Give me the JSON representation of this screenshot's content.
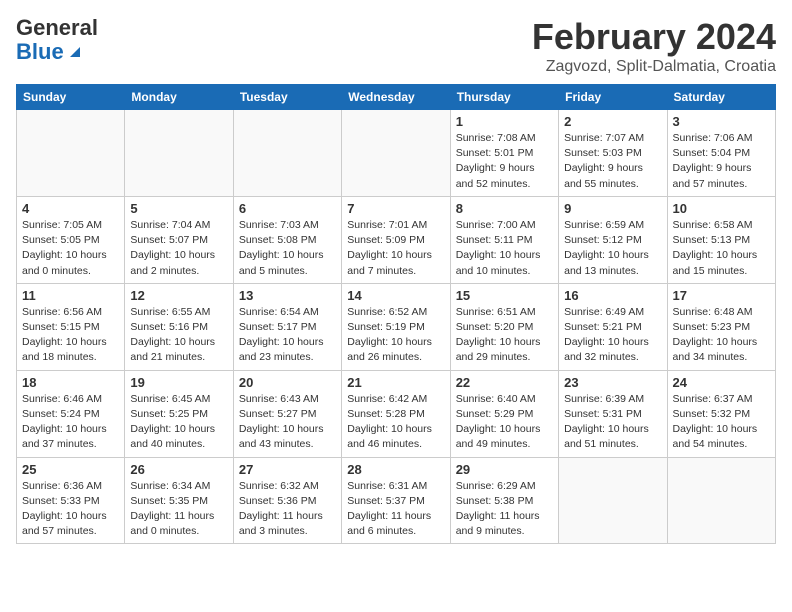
{
  "header": {
    "logo_line1": "General",
    "logo_line2": "Blue",
    "month": "February 2024",
    "location": "Zagvozd, Split-Dalmatia, Croatia"
  },
  "weekdays": [
    "Sunday",
    "Monday",
    "Tuesday",
    "Wednesday",
    "Thursday",
    "Friday",
    "Saturday"
  ],
  "weeks": [
    [
      {
        "day": "",
        "info": ""
      },
      {
        "day": "",
        "info": ""
      },
      {
        "day": "",
        "info": ""
      },
      {
        "day": "",
        "info": ""
      },
      {
        "day": "1",
        "info": "Sunrise: 7:08 AM\nSunset: 5:01 PM\nDaylight: 9 hours\nand 52 minutes."
      },
      {
        "day": "2",
        "info": "Sunrise: 7:07 AM\nSunset: 5:03 PM\nDaylight: 9 hours\nand 55 minutes."
      },
      {
        "day": "3",
        "info": "Sunrise: 7:06 AM\nSunset: 5:04 PM\nDaylight: 9 hours\nand 57 minutes."
      }
    ],
    [
      {
        "day": "4",
        "info": "Sunrise: 7:05 AM\nSunset: 5:05 PM\nDaylight: 10 hours\nand 0 minutes."
      },
      {
        "day": "5",
        "info": "Sunrise: 7:04 AM\nSunset: 5:07 PM\nDaylight: 10 hours\nand 2 minutes."
      },
      {
        "day": "6",
        "info": "Sunrise: 7:03 AM\nSunset: 5:08 PM\nDaylight: 10 hours\nand 5 minutes."
      },
      {
        "day": "7",
        "info": "Sunrise: 7:01 AM\nSunset: 5:09 PM\nDaylight: 10 hours\nand 7 minutes."
      },
      {
        "day": "8",
        "info": "Sunrise: 7:00 AM\nSunset: 5:11 PM\nDaylight: 10 hours\nand 10 minutes."
      },
      {
        "day": "9",
        "info": "Sunrise: 6:59 AM\nSunset: 5:12 PM\nDaylight: 10 hours\nand 13 minutes."
      },
      {
        "day": "10",
        "info": "Sunrise: 6:58 AM\nSunset: 5:13 PM\nDaylight: 10 hours\nand 15 minutes."
      }
    ],
    [
      {
        "day": "11",
        "info": "Sunrise: 6:56 AM\nSunset: 5:15 PM\nDaylight: 10 hours\nand 18 minutes."
      },
      {
        "day": "12",
        "info": "Sunrise: 6:55 AM\nSunset: 5:16 PM\nDaylight: 10 hours\nand 21 minutes."
      },
      {
        "day": "13",
        "info": "Sunrise: 6:54 AM\nSunset: 5:17 PM\nDaylight: 10 hours\nand 23 minutes."
      },
      {
        "day": "14",
        "info": "Sunrise: 6:52 AM\nSunset: 5:19 PM\nDaylight: 10 hours\nand 26 minutes."
      },
      {
        "day": "15",
        "info": "Sunrise: 6:51 AM\nSunset: 5:20 PM\nDaylight: 10 hours\nand 29 minutes."
      },
      {
        "day": "16",
        "info": "Sunrise: 6:49 AM\nSunset: 5:21 PM\nDaylight: 10 hours\nand 32 minutes."
      },
      {
        "day": "17",
        "info": "Sunrise: 6:48 AM\nSunset: 5:23 PM\nDaylight: 10 hours\nand 34 minutes."
      }
    ],
    [
      {
        "day": "18",
        "info": "Sunrise: 6:46 AM\nSunset: 5:24 PM\nDaylight: 10 hours\nand 37 minutes."
      },
      {
        "day": "19",
        "info": "Sunrise: 6:45 AM\nSunset: 5:25 PM\nDaylight: 10 hours\nand 40 minutes."
      },
      {
        "day": "20",
        "info": "Sunrise: 6:43 AM\nSunset: 5:27 PM\nDaylight: 10 hours\nand 43 minutes."
      },
      {
        "day": "21",
        "info": "Sunrise: 6:42 AM\nSunset: 5:28 PM\nDaylight: 10 hours\nand 46 minutes."
      },
      {
        "day": "22",
        "info": "Sunrise: 6:40 AM\nSunset: 5:29 PM\nDaylight: 10 hours\nand 49 minutes."
      },
      {
        "day": "23",
        "info": "Sunrise: 6:39 AM\nSunset: 5:31 PM\nDaylight: 10 hours\nand 51 minutes."
      },
      {
        "day": "24",
        "info": "Sunrise: 6:37 AM\nSunset: 5:32 PM\nDaylight: 10 hours\nand 54 minutes."
      }
    ],
    [
      {
        "day": "25",
        "info": "Sunrise: 6:36 AM\nSunset: 5:33 PM\nDaylight: 10 hours\nand 57 minutes."
      },
      {
        "day": "26",
        "info": "Sunrise: 6:34 AM\nSunset: 5:35 PM\nDaylight: 11 hours\nand 0 minutes."
      },
      {
        "day": "27",
        "info": "Sunrise: 6:32 AM\nSunset: 5:36 PM\nDaylight: 11 hours\nand 3 minutes."
      },
      {
        "day": "28",
        "info": "Sunrise: 6:31 AM\nSunset: 5:37 PM\nDaylight: 11 hours\nand 6 minutes."
      },
      {
        "day": "29",
        "info": "Sunrise: 6:29 AM\nSunset: 5:38 PM\nDaylight: 11 hours\nand 9 minutes."
      },
      {
        "day": "",
        "info": ""
      },
      {
        "day": "",
        "info": ""
      }
    ]
  ]
}
